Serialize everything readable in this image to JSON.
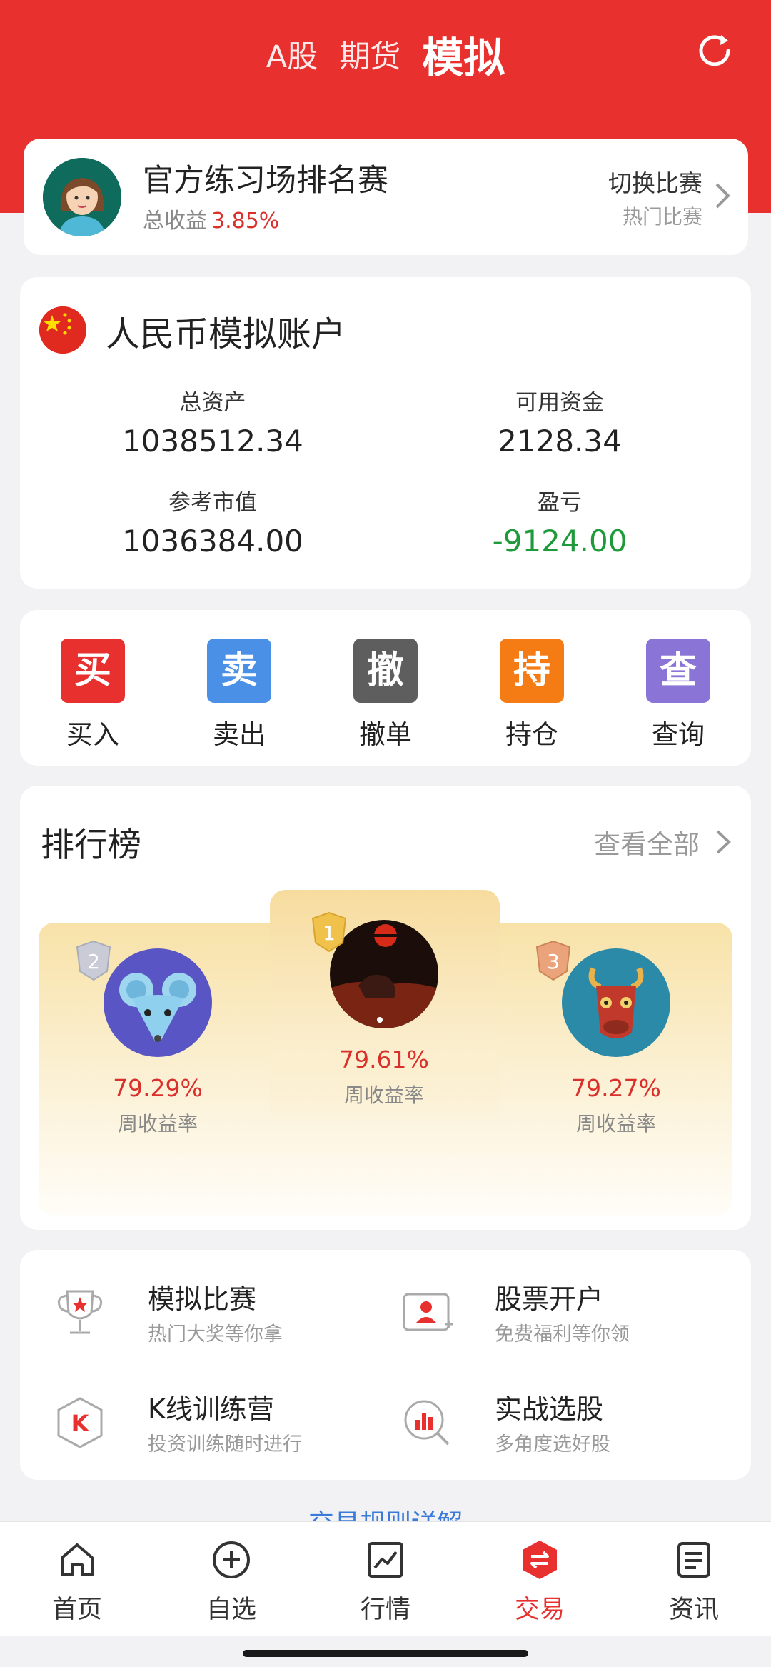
{
  "header": {
    "tabs": [
      "A股",
      "期货",
      "模拟"
    ],
    "active_tab": "模拟",
    "refresh_icon": "refresh-icon"
  },
  "contest": {
    "title": "官方练习场排名赛",
    "return_label": "总收益",
    "return_value": "3.85%",
    "switch_label": "切换比赛",
    "switch_sub": "热门比赛"
  },
  "account": {
    "title": "人民币模拟账户",
    "total_assets_label": "总资产",
    "total_assets": "1038512.34",
    "available_label": "可用资金",
    "available": "2128.34",
    "market_value_label": "参考市值",
    "market_value": "1036384.00",
    "pnl_label": "盈亏",
    "pnl": "-9124.00"
  },
  "actions": [
    {
      "icon_char": "买",
      "label": "买入",
      "color": "#e8302f"
    },
    {
      "icon_char": "卖",
      "label": "卖出",
      "color": "#4a90e6"
    },
    {
      "icon_char": "撤",
      "label": "撤单",
      "color": "#5e5e5e"
    },
    {
      "icon_char": "持",
      "label": "持仓",
      "color": "#f57b14"
    },
    {
      "icon_char": "查",
      "label": "查询",
      "color": "#8a74d6"
    }
  ],
  "ranking": {
    "title": "排行榜",
    "view_all": "查看全部",
    "entries": [
      {
        "rank": "1",
        "pct": "79.61%",
        "label": "周收益率"
      },
      {
        "rank": "2",
        "pct": "79.29%",
        "label": "周收益率"
      },
      {
        "rank": "3",
        "pct": "79.27%",
        "label": "周收益率"
      }
    ]
  },
  "features": [
    {
      "title": "模拟比赛",
      "sub": "热门大奖等你拿",
      "icon": "trophy-icon"
    },
    {
      "title": "股票开户",
      "sub": "免费福利等你领",
      "icon": "account-open-icon"
    },
    {
      "title": "K线训练营",
      "sub": "投资训练随时进行",
      "icon": "k-line-icon"
    },
    {
      "title": "实战选股",
      "sub": "多角度选好股",
      "icon": "stock-pick-icon"
    }
  ],
  "rules_link": "交易规则详解",
  "nav": [
    {
      "label": "首页",
      "icon": "home-icon"
    },
    {
      "label": "自选",
      "icon": "add-circle-icon"
    },
    {
      "label": "行情",
      "icon": "market-chart-icon"
    },
    {
      "label": "交易",
      "icon": "trade-icon"
    },
    {
      "label": "资讯",
      "icon": "news-icon"
    }
  ],
  "colors": {
    "brand_red": "#e8302f",
    "positive": "#d9302b",
    "negative": "#1f9a3a",
    "link": "#3a7ad8"
  }
}
